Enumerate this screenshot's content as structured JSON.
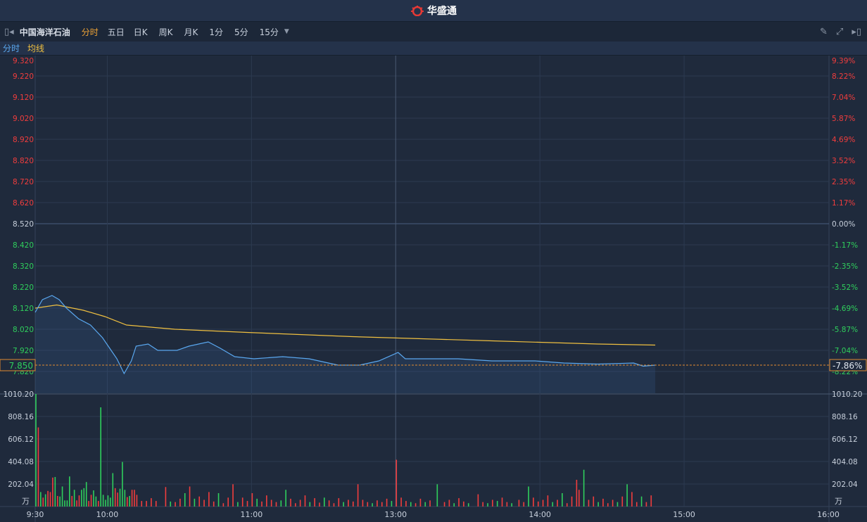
{
  "app": {
    "title": "华盛通",
    "logo_icon": "huashengtong-logo"
  },
  "toolbar": {
    "stock_name": "中国海洋石油",
    "tabs": [
      "分时",
      "五日",
      "日K",
      "周K",
      "月K",
      "1分",
      "5分",
      "15分"
    ],
    "active_tab": "分时",
    "icons": [
      "collapse-left-icon",
      "pencil-icon",
      "fullscreen-icon",
      "expand-right-icon"
    ]
  },
  "legend": {
    "line": "分时",
    "avg": "均线"
  },
  "colors": {
    "up": "#f23d3d",
    "down": "#2fcf5c",
    "price_line": "#5aa8f0",
    "avg_line": "#f0c040",
    "grid": "#2c3a50",
    "marker": "#e08a30"
  },
  "chart_data": {
    "type": "line",
    "prev_close": 8.52,
    "current_price": "7.850",
    "current_pct": "-7.86%",
    "left_ticks": [
      "9.320",
      "9.220",
      "9.120",
      "9.020",
      "8.920",
      "8.820",
      "8.720",
      "8.620",
      "8.520",
      "8.420",
      "8.320",
      "8.220",
      "8.120",
      "8.020",
      "7.920",
      "7.820"
    ],
    "right_ticks": [
      "9.39%",
      "8.22%",
      "7.04%",
      "5.87%",
      "4.69%",
      "3.52%",
      "2.35%",
      "1.17%",
      "0.00%",
      "-1.17%",
      "-2.35%",
      "-3.52%",
      "-4.69%",
      "-5.87%",
      "-7.04%",
      "-8.22%"
    ],
    "volume_ticks": [
      "1010.20",
      "808.16",
      "606.12",
      "404.08",
      "202.04"
    ],
    "volume_unit": "万",
    "volume_max": 1010.2,
    "time_labels": [
      [
        "9:30",
        0
      ],
      [
        "10:00",
        30
      ],
      [
        "11:00",
        90
      ],
      [
        "13:00",
        150
      ],
      [
        "14:00",
        210
      ],
      [
        "15:00",
        270
      ],
      [
        "16:00",
        330
      ]
    ],
    "price": [
      [
        0,
        8.1
      ],
      [
        3,
        8.16
      ],
      [
        7,
        8.18
      ],
      [
        10,
        8.16
      ],
      [
        13,
        8.12
      ],
      [
        18,
        8.07
      ],
      [
        23,
        8.04
      ],
      [
        28,
        7.98
      ],
      [
        31,
        7.93
      ],
      [
        34,
        7.88
      ],
      [
        37,
        7.81
      ],
      [
        40,
        7.87
      ],
      [
        42,
        7.94
      ],
      [
        47,
        7.95
      ],
      [
        51,
        7.92
      ],
      [
        59,
        7.92
      ],
      [
        64,
        7.94
      ],
      [
        72,
        7.96
      ],
      [
        77,
        7.93
      ],
      [
        83,
        7.89
      ],
      [
        91,
        7.88
      ],
      [
        103,
        7.89
      ],
      [
        114,
        7.88
      ],
      [
        126,
        7.85
      ],
      [
        135,
        7.85
      ],
      [
        143,
        7.87
      ],
      [
        151,
        7.91
      ],
      [
        154,
        7.88
      ],
      [
        161,
        7.88
      ],
      [
        176,
        7.88
      ],
      [
        190,
        7.87
      ],
      [
        208,
        7.87
      ],
      [
        220,
        7.86
      ],
      [
        234,
        7.855
      ],
      [
        249,
        7.86
      ],
      [
        253,
        7.845
      ],
      [
        258,
        7.85
      ]
    ],
    "avg": [
      [
        0,
        8.12
      ],
      [
        9,
        8.135
      ],
      [
        20,
        8.11
      ],
      [
        29,
        8.08
      ],
      [
        38,
        8.04
      ],
      [
        58,
        8.02
      ],
      [
        88,
        8.005
      ],
      [
        132,
        7.985
      ],
      [
        190,
        7.965
      ],
      [
        234,
        7.95
      ],
      [
        258,
        7.945
      ]
    ],
    "volume": [
      [
        0,
        1010,
        0
      ],
      [
        1,
        710,
        1
      ],
      [
        2,
        130,
        0
      ],
      [
        3,
        80,
        1
      ],
      [
        4,
        110,
        0
      ],
      [
        5,
        140,
        1
      ],
      [
        6,
        130,
        1
      ],
      [
        7,
        260,
        1
      ],
      [
        8,
        265,
        0
      ],
      [
        9,
        95,
        1
      ],
      [
        10,
        90,
        0
      ],
      [
        11,
        180,
        0
      ],
      [
        12,
        55,
        0
      ],
      [
        13,
        55,
        0
      ],
      [
        14,
        270,
        0
      ],
      [
        15,
        95,
        1
      ],
      [
        16,
        150,
        0
      ],
      [
        17,
        55,
        1
      ],
      [
        18,
        100,
        1
      ],
      [
        19,
        150,
        0
      ],
      [
        20,
        165,
        0
      ],
      [
        21,
        220,
        0
      ],
      [
        22,
        50,
        1
      ],
      [
        23,
        105,
        1
      ],
      [
        24,
        145,
        0
      ],
      [
        25,
        90,
        0
      ],
      [
        26,
        50,
        1
      ],
      [
        27,
        890,
        0
      ],
      [
        28,
        105,
        0
      ],
      [
        29,
        60,
        0
      ],
      [
        30,
        100,
        0
      ],
      [
        31,
        80,
        0
      ],
      [
        32,
        300,
        0
      ],
      [
        33,
        165,
        1
      ],
      [
        34,
        125,
        1
      ],
      [
        35,
        160,
        0
      ],
      [
        36,
        400,
        0
      ],
      [
        37,
        150,
        0
      ],
      [
        38,
        85,
        1
      ],
      [
        39,
        95,
        0
      ],
      [
        40,
        150,
        1
      ],
      [
        41,
        150,
        1
      ],
      [
        42,
        105,
        1
      ],
      [
        44,
        50,
        1
      ],
      [
        46,
        50,
        1
      ],
      [
        48,
        75,
        1
      ],
      [
        50,
        50,
        1
      ],
      [
        54,
        175,
        1
      ],
      [
        56,
        45,
        0
      ],
      [
        58,
        40,
        1
      ],
      [
        60,
        70,
        1
      ],
      [
        62,
        120,
        0
      ],
      [
        64,
        180,
        1
      ],
      [
        66,
        70,
        0
      ],
      [
        68,
        90,
        1
      ],
      [
        70,
        60,
        1
      ],
      [
        72,
        130,
        1
      ],
      [
        74,
        45,
        1
      ],
      [
        76,
        120,
        0
      ],
      [
        78,
        30,
        1
      ],
      [
        80,
        80,
        1
      ],
      [
        82,
        200,
        1
      ],
      [
        84,
        40,
        0
      ],
      [
        86,
        80,
        1
      ],
      [
        88,
        50,
        1
      ],
      [
        90,
        120,
        1
      ],
      [
        92,
        70,
        0
      ],
      [
        94,
        45,
        1
      ],
      [
        96,
        100,
        1
      ],
      [
        98,
        60,
        1
      ],
      [
        100,
        40,
        1
      ],
      [
        102,
        55,
        0
      ],
      [
        104,
        150,
        0
      ],
      [
        106,
        70,
        1
      ],
      [
        108,
        30,
        1
      ],
      [
        110,
        60,
        1
      ],
      [
        112,
        100,
        1
      ],
      [
        114,
        40,
        0
      ],
      [
        116,
        75,
        1
      ],
      [
        118,
        35,
        1
      ],
      [
        120,
        80,
        0
      ],
      [
        122,
        55,
        1
      ],
      [
        124,
        30,
        1
      ],
      [
        126,
        75,
        1
      ],
      [
        128,
        40,
        0
      ],
      [
        130,
        60,
        1
      ],
      [
        132,
        45,
        1
      ],
      [
        134,
        200,
        1
      ],
      [
        136,
        60,
        1
      ],
      [
        138,
        40,
        1
      ],
      [
        140,
        30,
        0
      ],
      [
        142,
        55,
        1
      ],
      [
        144,
        40,
        1
      ],
      [
        146,
        70,
        1
      ],
      [
        148,
        50,
        0
      ],
      [
        150,
        420,
        1
      ],
      [
        152,
        80,
        1
      ],
      [
        154,
        50,
        1
      ],
      [
        156,
        40,
        0
      ],
      [
        158,
        30,
        1
      ],
      [
        160,
        70,
        1
      ],
      [
        162,
        40,
        0
      ],
      [
        164,
        55,
        1
      ],
      [
        167,
        200,
        0
      ],
      [
        170,
        40,
        1
      ],
      [
        172,
        60,
        1
      ],
      [
        174,
        30,
        0
      ],
      [
        176,
        75,
        1
      ],
      [
        178,
        45,
        1
      ],
      [
        180,
        30,
        0
      ],
      [
        184,
        110,
        1
      ],
      [
        186,
        40,
        1
      ],
      [
        188,
        30,
        0
      ],
      [
        190,
        60,
        1
      ],
      [
        192,
        50,
        0
      ],
      [
        194,
        80,
        1
      ],
      [
        196,
        40,
        1
      ],
      [
        198,
        30,
        0
      ],
      [
        201,
        60,
        1
      ],
      [
        203,
        40,
        1
      ],
      [
        205,
        180,
        0
      ],
      [
        207,
        80,
        1
      ],
      [
        209,
        45,
        1
      ],
      [
        211,
        60,
        1
      ],
      [
        213,
        100,
        1
      ],
      [
        215,
        40,
        0
      ],
      [
        217,
        60,
        1
      ],
      [
        219,
        120,
        0
      ],
      [
        221,
        30,
        1
      ],
      [
        223,
        90,
        1
      ],
      [
        225,
        240,
        1
      ],
      [
        226,
        150,
        1
      ],
      [
        228,
        330,
        0
      ],
      [
        230,
        60,
        1
      ],
      [
        232,
        90,
        1
      ],
      [
        234,
        40,
        0
      ],
      [
        236,
        70,
        1
      ],
      [
        238,
        30,
        1
      ],
      [
        240,
        60,
        1
      ],
      [
        242,
        40,
        0
      ],
      [
        244,
        90,
        1
      ],
      [
        246,
        200,
        0
      ],
      [
        248,
        130,
        1
      ],
      [
        250,
        40,
        1
      ],
      [
        252,
        90,
        0
      ],
      [
        254,
        40,
        1
      ],
      [
        256,
        100,
        1
      ]
    ]
  }
}
